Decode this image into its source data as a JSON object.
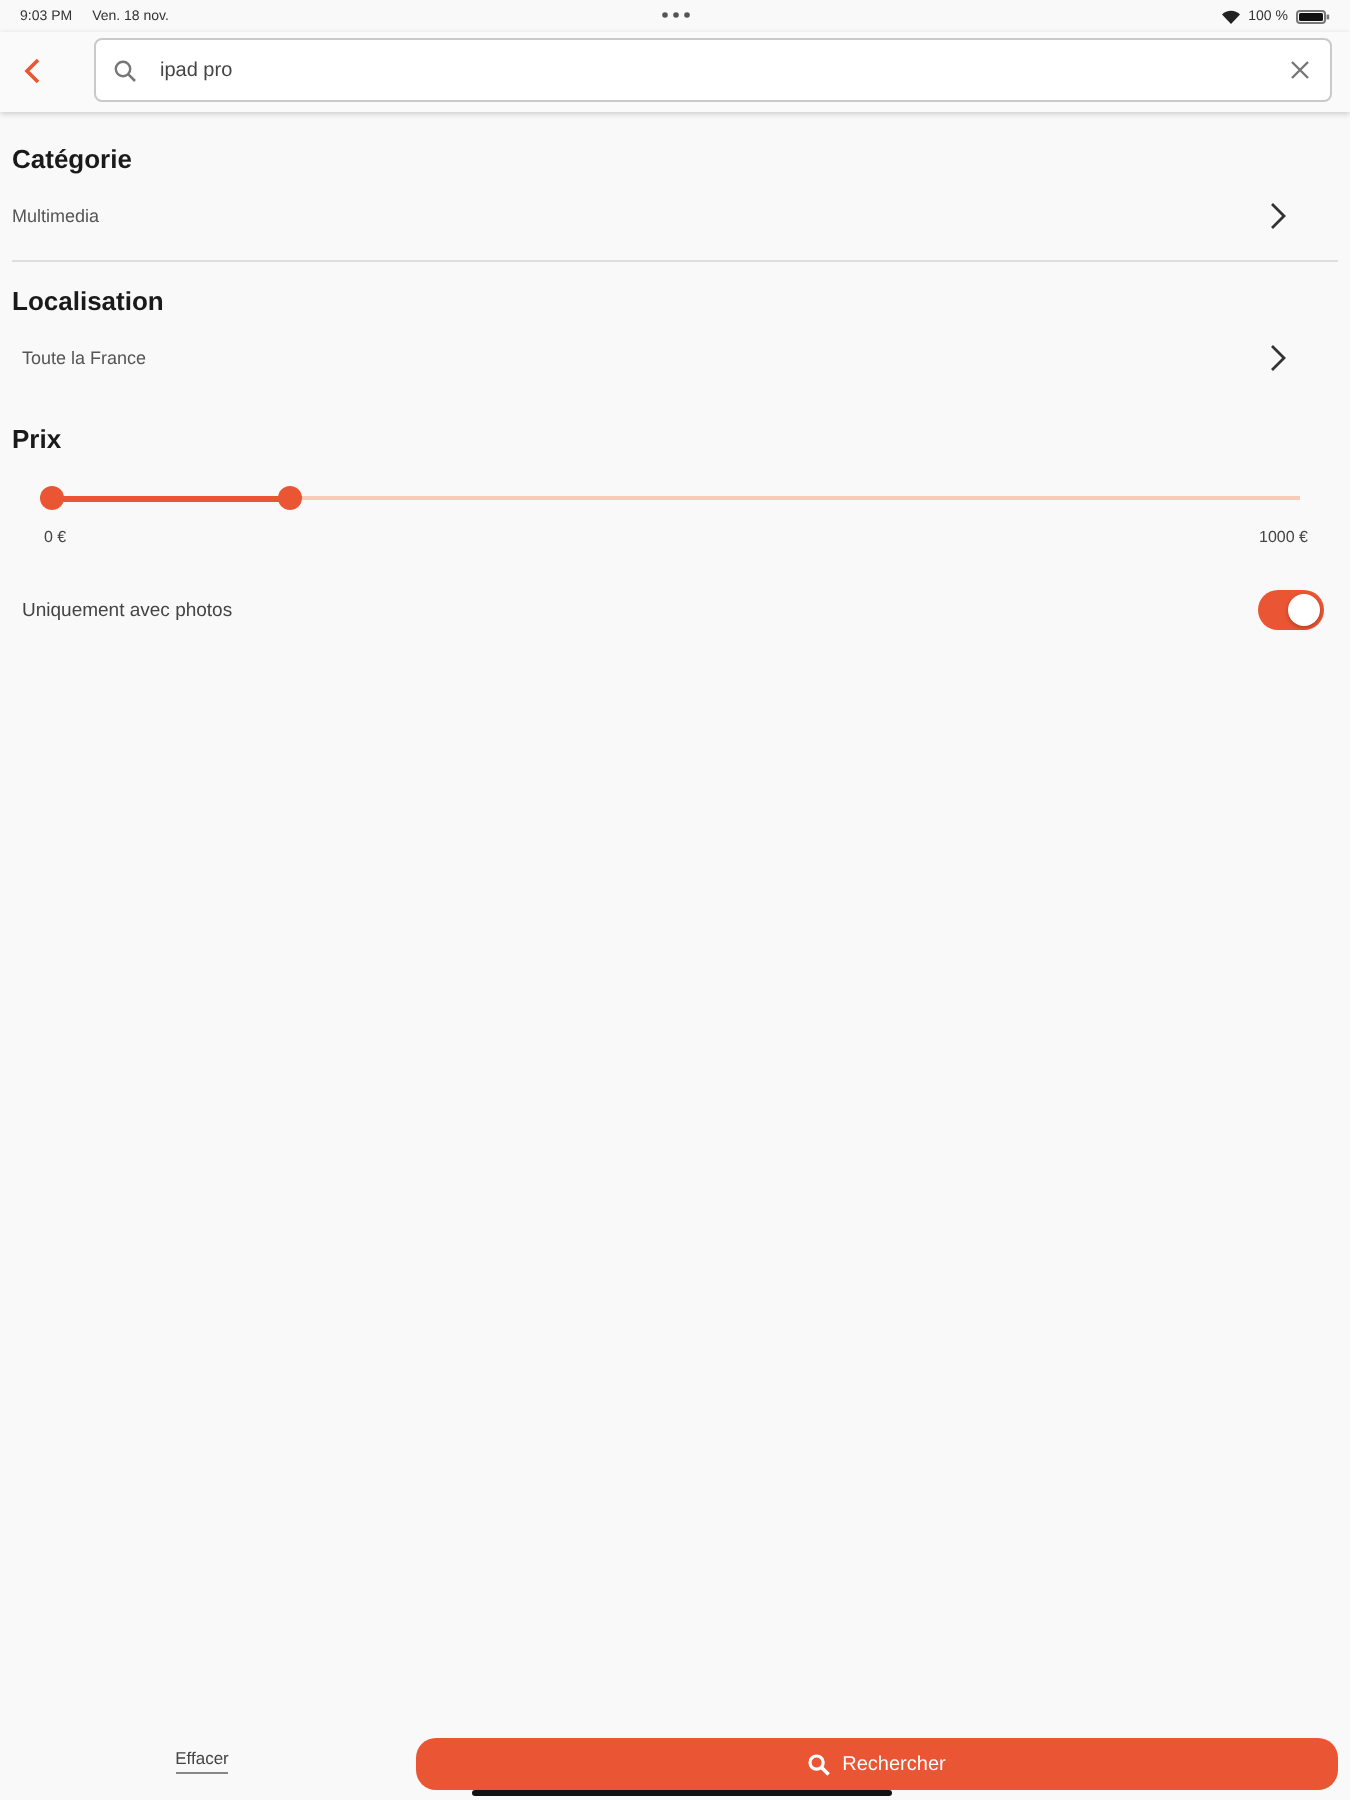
{
  "status_bar": {
    "time": "9:03 PM",
    "date": "Ven. 18 nov.",
    "battery": "100 %"
  },
  "search": {
    "value": "ipad pro"
  },
  "filters": [
    {
      "title": "Catégorie",
      "value": "Multimedia"
    },
    {
      "title": "Localisation",
      "value": "Toute la France"
    }
  ],
  "price": {
    "title": "Prix",
    "handles": [
      {
        "level": 0
      },
      {
        "level": 0.19
      }
    ],
    "min_label": "0 €",
    "max_label": "1000 €"
  },
  "photos_only": {
    "label": "Uniquement avec photos",
    "on": true
  },
  "actions": {
    "clear": "Effacer",
    "search": "Rechercher"
  }
}
